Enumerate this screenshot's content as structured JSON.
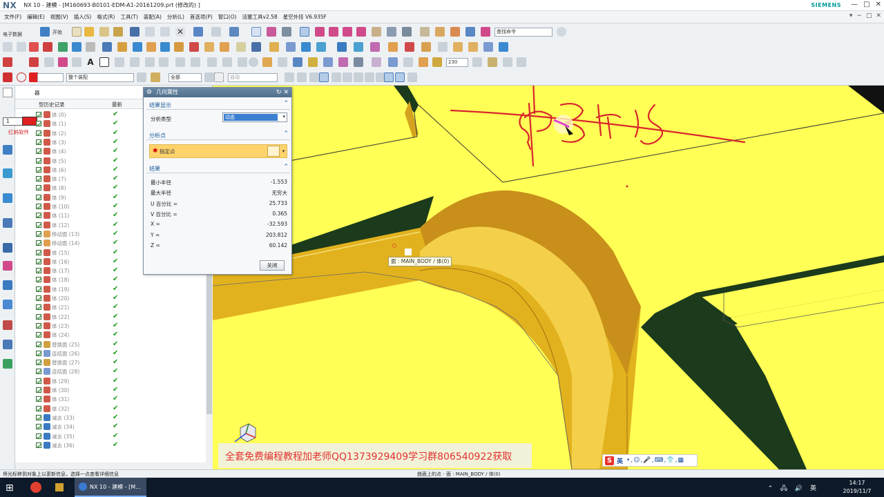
{
  "window": {
    "logo": "NX",
    "title": "NX 10 - 建模 - [M160693-B0101-EDM-A1-20161209.prt  (修改的)  ]",
    "brand": "SIEMENS",
    "controls": [
      "—",
      "□",
      "✕"
    ]
  },
  "menu": {
    "items": [
      "文件(F)",
      "编辑(E)",
      "视图(V)",
      "插入(S)",
      "格式(R)",
      "工具(T)",
      "装配(A)",
      "分析(L)",
      "首选项(P)",
      "窗口(O)",
      "活塞工具v2.58",
      "星空外挂 V6.935F"
    ],
    "right": [
      "▾",
      "−",
      "□",
      "✕"
    ]
  },
  "toolbar": {
    "e_label": "电子数据",
    "start_label": "开始",
    "search_placeholder": "查找命令",
    "assembly_scope": "整个装配",
    "filter_all": "全部",
    "orient": "自动",
    "zoom_value": "230",
    "plus_label": "+",
    "text_glyph": "A"
  },
  "navigator": {
    "selector_value": "1",
    "red_label": "红蚂软件",
    "model_label": "器",
    "history_label": "型历史记录",
    "col_latest": "最新",
    "rows": [
      {
        "label": "体 (0)",
        "kind": "body"
      },
      {
        "label": "体 (1)",
        "kind": "body"
      },
      {
        "label": "体 (2)",
        "kind": "body"
      },
      {
        "label": "体 (3)",
        "kind": "body"
      },
      {
        "label": "体 (4)",
        "kind": "body"
      },
      {
        "label": "体 (5)",
        "kind": "body"
      },
      {
        "label": "体 (6)",
        "kind": "body"
      },
      {
        "label": "体 (7)",
        "kind": "body"
      },
      {
        "label": "体 (8)",
        "kind": "body"
      },
      {
        "label": "体 (9)",
        "kind": "body"
      },
      {
        "label": "体 (10)",
        "kind": "body"
      },
      {
        "label": "体 (11)",
        "kind": "body"
      },
      {
        "label": "体 (12)",
        "kind": "body"
      },
      {
        "label": "移动面 (13)",
        "kind": "move"
      },
      {
        "label": "移动面 (14)",
        "kind": "move"
      },
      {
        "label": "体 (15)",
        "kind": "body"
      },
      {
        "label": "体 (16)",
        "kind": "body"
      },
      {
        "label": "体 (17)",
        "kind": "body"
      },
      {
        "label": "体 (18)",
        "kind": "body"
      },
      {
        "label": "体 (19)",
        "kind": "body"
      },
      {
        "label": "体 (20)",
        "kind": "body"
      },
      {
        "label": "体 (21)",
        "kind": "body"
      },
      {
        "label": "体 (22)",
        "kind": "body"
      },
      {
        "label": "体 (23)",
        "kind": "body"
      },
      {
        "label": "体 (24)",
        "kind": "body"
      },
      {
        "label": "替换面 (25)",
        "kind": "replace"
      },
      {
        "label": "连结面 (26)",
        "kind": "join"
      },
      {
        "label": "替换面 (27)",
        "kind": "replace"
      },
      {
        "label": "连结面 (28)",
        "kind": "join"
      },
      {
        "label": "体 (29)",
        "kind": "body"
      },
      {
        "label": "体 (30)",
        "kind": "body"
      },
      {
        "label": "体 (31)",
        "kind": "body"
      },
      {
        "label": "体 (32)",
        "kind": "body"
      },
      {
        "label": "减去 (33)",
        "kind": "subtract"
      },
      {
        "label": "减去 (34)",
        "kind": "subtract"
      },
      {
        "label": "减去 (35)",
        "kind": "subtract"
      },
      {
        "label": "减去 (36)",
        "kind": "subtract"
      }
    ]
  },
  "dialog": {
    "title": "几何属性",
    "sec_display": "结果显示",
    "analysis_type_label": "分析类型",
    "analysis_type_value": "动态",
    "sec_point": "分析点",
    "point_label": "指定点",
    "sec_result": "结果",
    "results": [
      {
        "label": "最小半径",
        "value": "-1.553"
      },
      {
        "label": "最大半径",
        "value": "无穷大"
      },
      {
        "label": "U 百分比 =",
        "value": "25.733"
      },
      {
        "label": "V 百分比 =",
        "value": "0.365"
      },
      {
        "label": "X =",
        "value": "-32.593"
      },
      {
        "label": "Y =",
        "value": "203.812"
      },
      {
        "label": "Z =",
        "value": "60.142"
      }
    ],
    "close_label": "关闭"
  },
  "viewport": {
    "tooltip": "面 : MAIN_BODY / 体(0)",
    "banner": "全套免费编程教程加老师QQ1373929409学习群806540922获取",
    "colors": {
      "surface": "#ffff55",
      "dark": "#1c3a1c",
      "fillet": "#e2b21e",
      "ink": "#d8242c"
    }
  },
  "ime": {
    "logo": "S",
    "lang": "英",
    "tools": "•,☺,🎤,⌨,👕,▦"
  },
  "status": {
    "left": "将光标移到对象上以更新信息，选择一点查看详细信息",
    "mid": "曲面上的点 - 面 : MAIN_BODY / 体(0)"
  },
  "taskbar": {
    "start": "⊞",
    "active_task": "NX 10 - 建模 - [M...",
    "tray": "⌃ 🖧 🔊 英",
    "time": "14:17",
    "date": "2019/11/7"
  }
}
